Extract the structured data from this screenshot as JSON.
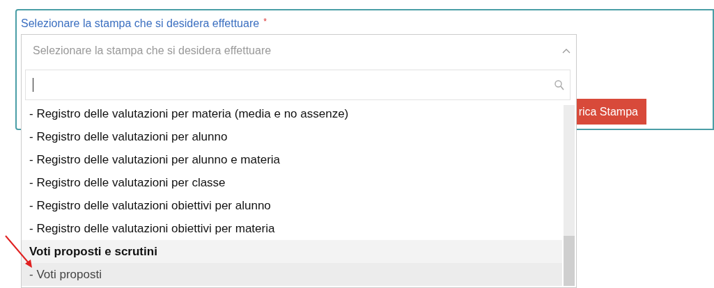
{
  "field": {
    "label": "Selezionare la stampa che si desidera effettuare",
    "required_mark": "*",
    "placeholder": "Selezionare la stampa che si desidera effettuare",
    "expanded": true
  },
  "search": {
    "focused": true
  },
  "options": [
    {
      "kind": "option",
      "label": "- Registro delle valutazioni per materia (media e no assenze)",
      "highlighted": false
    },
    {
      "kind": "option",
      "label": "- Registro delle valutazioni per alunno",
      "highlighted": false
    },
    {
      "kind": "option",
      "label": "- Registro delle valutazioni per alunno e materia",
      "highlighted": false
    },
    {
      "kind": "option",
      "label": "- Registro delle valutazioni per classe",
      "highlighted": false
    },
    {
      "kind": "option",
      "label": "- Registro delle valutazioni obiettivi per alunno",
      "highlighted": false
    },
    {
      "kind": "option",
      "label": "- Registro delle valutazioni obiettivi per materia",
      "highlighted": false
    },
    {
      "kind": "group",
      "label": "Voti proposti e scrutini",
      "highlighted": false
    },
    {
      "kind": "option",
      "label": "- Voti proposti",
      "highlighted": true
    }
  ],
  "button": {
    "label": "rica Stampa"
  }
}
